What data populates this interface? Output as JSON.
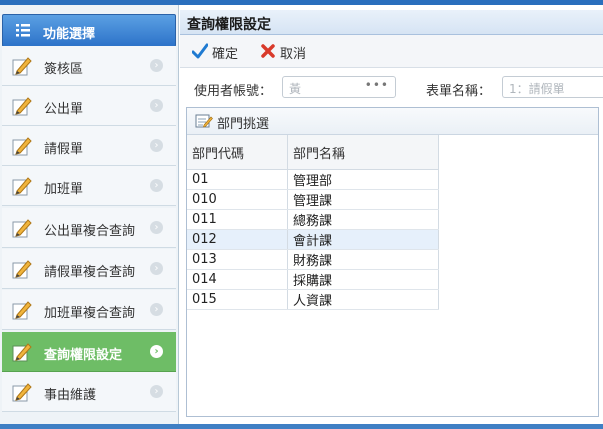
{
  "sidebar": {
    "header": "功能選擇",
    "items": [
      {
        "label": "簽核區"
      },
      {
        "label": "公出單"
      },
      {
        "label": "請假單"
      },
      {
        "label": "加班單"
      },
      {
        "label": "公出單複合查詢"
      },
      {
        "label": "請假單複合查詢"
      },
      {
        "label": "加班單複合查詢"
      },
      {
        "label": "查詢權限設定",
        "active": true
      },
      {
        "label": "事由維護"
      }
    ]
  },
  "panel": {
    "title": "查詢權限設定"
  },
  "toolbar": {
    "confirm_label": "確定",
    "cancel_label": "取消"
  },
  "form": {
    "user_label": "使用者帳號：",
    "user_value": "黃",
    "form_label": "表單名稱：",
    "form_placeholder": "1：請假單"
  },
  "grid": {
    "select_label": "部門挑選",
    "columns": [
      "部門代碼",
      "部門名稱"
    ],
    "rows": [
      {
        "code": "01",
        "name": "管理部"
      },
      {
        "code": "010",
        "name": "管理課"
      },
      {
        "code": "011",
        "name": "總務課"
      },
      {
        "code": "012",
        "name": "會計課"
      },
      {
        "code": "013",
        "name": "財務課"
      },
      {
        "code": "014",
        "name": "採購課"
      },
      {
        "code": "015",
        "name": "人資課"
      }
    ],
    "selected_row": 3
  },
  "colors": {
    "accent": "#2d73c9",
    "active_item": "#6ebd66",
    "confirm_icon": "#1f7ad1",
    "cancel_icon": "#d93a2b"
  }
}
